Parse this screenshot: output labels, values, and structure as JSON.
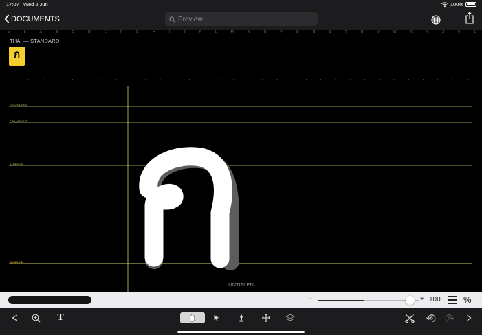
{
  "status": {
    "time": "17:07",
    "date": "Wed 2 Jun",
    "battery": "100%"
  },
  "nav": {
    "back_label": "DOCUMENTS",
    "search_placeholder": "Preview"
  },
  "glyph_set": {
    "title": "THAI — STANDARD",
    "top_row": [
      "a",
      "b",
      "A",
      "B",
      "C",
      "D",
      "E",
      "F",
      "G",
      "H",
      "I",
      "J",
      "K",
      "L",
      "M",
      "N",
      "O",
      "P",
      "Q",
      "R",
      "S",
      "T",
      "U",
      "V",
      "W",
      "X",
      "Y",
      "Z",
      "0",
      "1"
    ],
    "selected": {
      "glyph": "ก",
      "dot": "•"
    },
    "small_row": [
      "–",
      "–",
      "–",
      "–",
      "–",
      "–",
      "–",
      "–",
      "–",
      "–",
      "–",
      "–",
      "–",
      "–",
      "–",
      "–",
      "–",
      "–",
      "–",
      "–",
      "–",
      "–",
      "–",
      "–",
      "–",
      "–",
      "–",
      "–",
      "–",
      "–",
      "–",
      "–",
      "–",
      "–"
    ],
    "bottom_row": [
      "'",
      "'",
      "'",
      "'",
      "'",
      "'",
      "'",
      "'",
      "'",
      "'",
      "'",
      "'",
      "'",
      "'",
      "'",
      "'",
      "'",
      "'",
      "'",
      "'",
      "'",
      "'",
      "'",
      "'",
      "'",
      "'",
      "'",
      "'",
      "'",
      "'",
      "'",
      "'"
    ]
  },
  "guides": {
    "descender": "DESCENDER",
    "cap_height": "CAP_HEIGHT",
    "x_height": "X_HEIGHT",
    "baseline": "BASELINE"
  },
  "canvas": {
    "title": "UNTITLED"
  },
  "controls": {
    "zoom_minus": "-",
    "zoom_plus": "+",
    "zoom_value": "100",
    "zoom_fraction": 0.46,
    "percent_icon": "%"
  },
  "colors": {
    "accent": "#f5cf2c",
    "guide": "#cfcf72",
    "toolbar": "#1c1c1e"
  },
  "toolbar_icons": [
    "back-arrow-icon",
    "zoom-icon",
    "text-icon",
    "pen-tool-icon",
    "pointer-icon",
    "brush-icon",
    "move-icon",
    "layers-icon",
    "tools-icon",
    "undo-icon",
    "redo-icon",
    "play-icon"
  ]
}
